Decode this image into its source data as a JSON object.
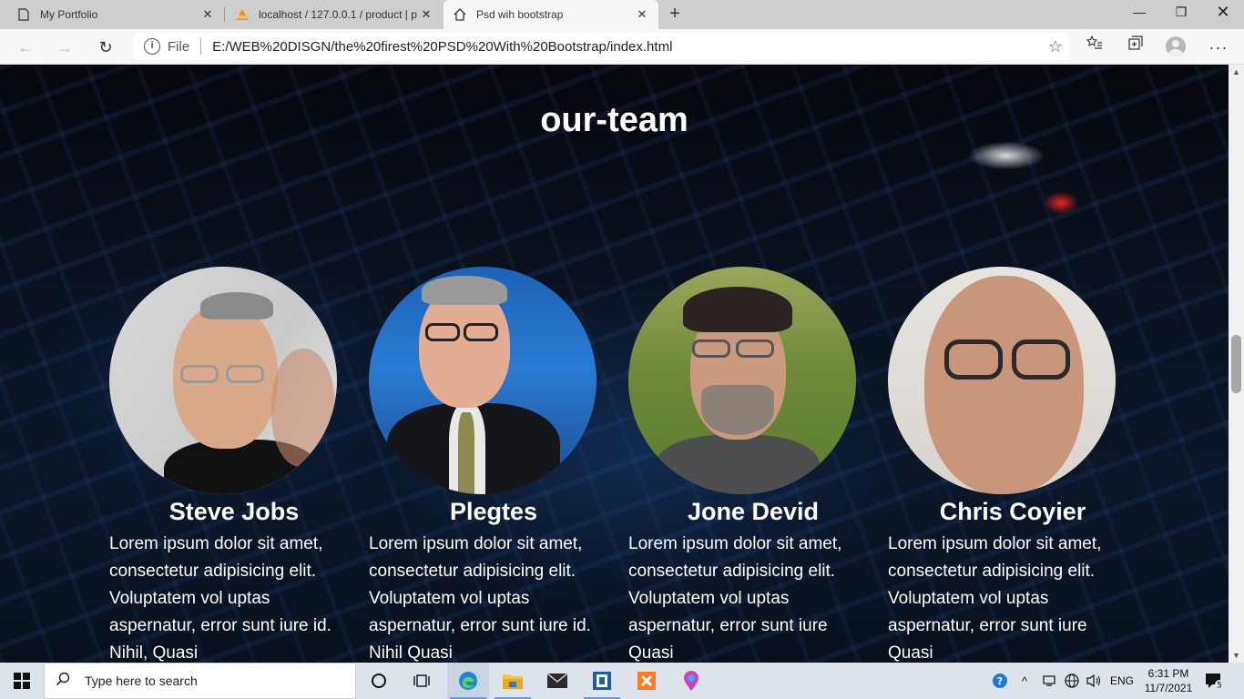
{
  "browser": {
    "tabs": [
      {
        "title": "My Portfolio",
        "icon": "page-icon"
      },
      {
        "title": "localhost / 127.0.0.1 / product | p",
        "icon": "phpmyadmin-icon"
      },
      {
        "title": "Psd wih bootstrap",
        "icon": "home-icon",
        "active": true
      }
    ],
    "address": {
      "scheme_label": "File",
      "url": "E:/WEB%20DISGN/the%20firest%20PSD%20With%20Bootstrap/index.html"
    }
  },
  "page": {
    "section_title": "our-team",
    "members": [
      {
        "name": "Steve Jobs",
        "bio": "Lorem ipsum dolor sit amet, consectetur adipisicing elit. Voluptatem vol uptas aspernatur, error sunt iure id. Nihil, Quasi"
      },
      {
        "name": "Plegtes",
        "bio": "Lorem ipsum dolor sit amet, consectetur adipisicing elit. Voluptatem vol uptas aspernatur, error sunt iure id. Nihil Quasi"
      },
      {
        "name": "Jone Devid",
        "bio": "Lorem ipsum dolor sit amet, consectetur adipisicing elit. Voluptatem vol uptas aspernatur, error sunt iure Quasi"
      },
      {
        "name": "Chris Coyier",
        "bio": "Lorem ipsum dolor sit amet, consectetur adipisicing elit. Voluptatem vol uptas aspernatur, error sunt iure Quasi"
      }
    ]
  },
  "taskbar": {
    "search_placeholder": "Type here to search",
    "language": "ENG",
    "time": "6:31 PM",
    "date": "11/7/2021",
    "notification_count": "5"
  },
  "colors": {
    "tab_strip": "#cecece",
    "toolbar": "#f7f7f7",
    "taskbar": "#dde3ea",
    "page_text": "#ffffff"
  }
}
